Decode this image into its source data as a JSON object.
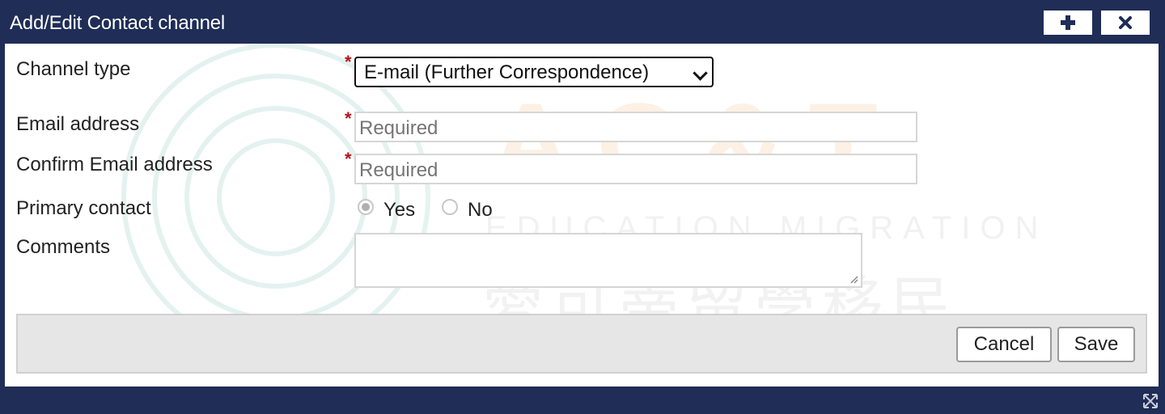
{
  "dialog": {
    "title": "Add/Edit Contact channel",
    "maximize_icon": "plus-icon",
    "close_icon": "close-icon"
  },
  "watermark": {
    "logo_text": "AC&T",
    "subtitle": "EDUCATION MIGRATION",
    "cjk": "愛可蒂留學移民"
  },
  "form": {
    "channel_type": {
      "label": "Channel type",
      "value": "E-mail (Further Correspondence)",
      "required_mark": "*"
    },
    "email": {
      "label": "Email address",
      "placeholder": "Required",
      "required_mark": "*"
    },
    "confirm_email": {
      "label": "Confirm Email address",
      "placeholder": "Required",
      "required_mark": "*"
    },
    "primary_contact": {
      "label": "Primary contact",
      "options": [
        "Yes",
        "No"
      ],
      "selected": "Yes"
    },
    "comments": {
      "label": "Comments"
    }
  },
  "footer": {
    "cancel_label": "Cancel",
    "save_label": "Save"
  },
  "colors": {
    "titlebar": "#1f2d57",
    "required": "#b5121b"
  }
}
